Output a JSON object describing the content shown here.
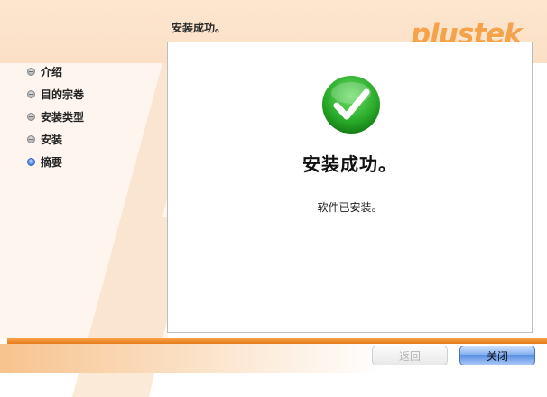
{
  "header": {
    "title": "安装成功。"
  },
  "brand": {
    "logo_text": "plustek",
    "accent_color": "#f6a24b"
  },
  "sidebar": {
    "steps": [
      {
        "label": "介绍",
        "state": "done"
      },
      {
        "label": "目的宗卷",
        "state": "done"
      },
      {
        "label": "安装类型",
        "state": "done"
      },
      {
        "label": "安装",
        "state": "done"
      },
      {
        "label": "摘要",
        "state": "current"
      }
    ]
  },
  "main": {
    "status_icon": "success-check-icon",
    "title": "安装成功。",
    "message": "软件已安装。"
  },
  "footer": {
    "back_label": "返回",
    "back_enabled": false,
    "close_label": "关闭"
  }
}
